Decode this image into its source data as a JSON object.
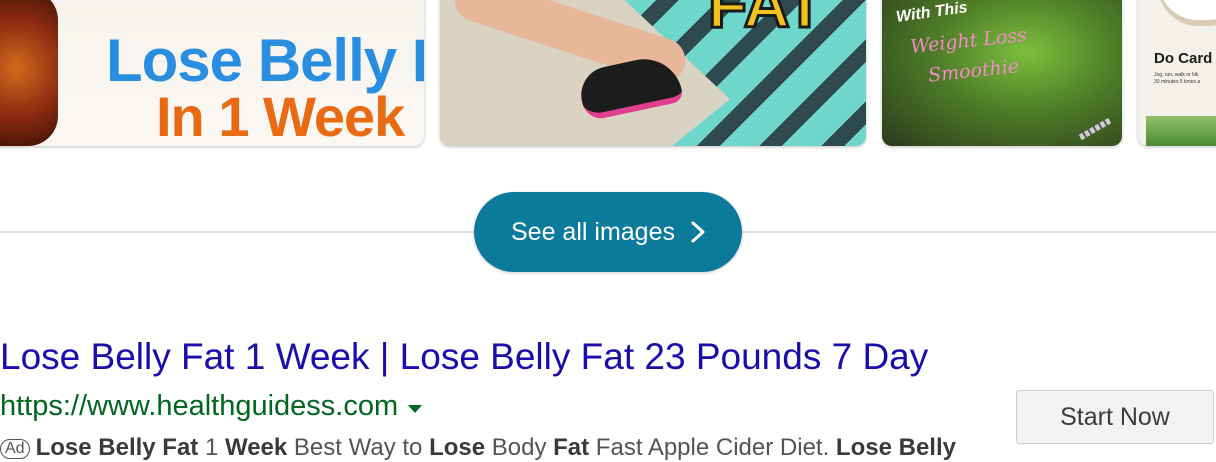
{
  "images": {
    "thumb1": {
      "line1": "Lose Belly F",
      "line2": "In 1 Week"
    },
    "thumb2": {
      "big_text": "FAT"
    },
    "thumb3": {
      "line1": "With This",
      "line2": "Weight Loss",
      "line3": "Smoothie"
    },
    "thumb4": {
      "title": "Do Card",
      "sub1": "Jog, run, walk or bik",
      "sub2": "30 minutes 5 times a"
    },
    "see_all_label": "See all images",
    "colors": {
      "button": "#0c7a9b"
    }
  },
  "ad": {
    "title": "Lose Belly Fat 1 Week | Lose Belly Fat 23 Pounds 7 Day",
    "url": "https://www.healthguidess.com",
    "badge": "Ad",
    "snippet": [
      {
        "text": "Lose Belly Fat",
        "bold": true
      },
      {
        "text": " 1 ",
        "bold": false
      },
      {
        "text": "Week",
        "bold": true
      },
      {
        "text": " Best Way to ",
        "bold": false
      },
      {
        "text": "Lose",
        "bold": true
      },
      {
        "text": " Body ",
        "bold": false
      },
      {
        "text": "Fat",
        "bold": true
      },
      {
        "text": " Fast Apple Cider Diet. ",
        "bold": false
      },
      {
        "text": "Lose Belly",
        "bold": true
      }
    ],
    "cta_label": "Start Now",
    "colors": {
      "title": "#1a0dab",
      "url": "#006621"
    }
  }
}
